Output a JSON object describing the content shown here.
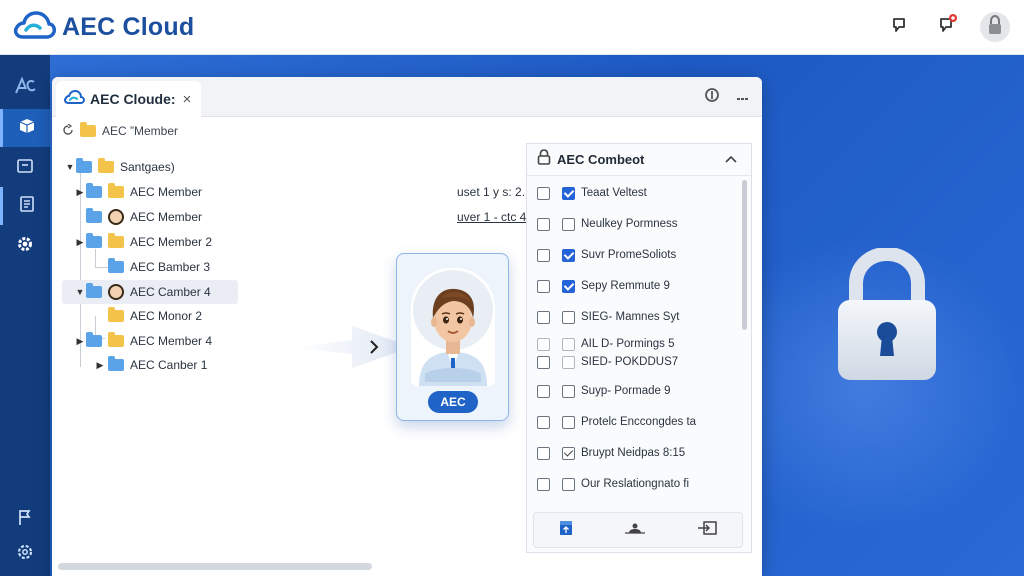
{
  "header": {
    "app_name": "AEC Cloud",
    "icons": [
      "cloud-logo-icon",
      "chat-icon",
      "notification-bell-icon",
      "user-avatar"
    ]
  },
  "rail": {
    "items": [
      "ae-logo-icon",
      "box-icon",
      "folder-icon",
      "document-icon",
      "gear-icon"
    ],
    "bottom_items": [
      "flag-icon",
      "settings-icon"
    ]
  },
  "window": {
    "tab_title": "AEC Cloude:",
    "tab_close": "×"
  },
  "breadcrumb": {
    "item": "AEC ”Member"
  },
  "tree": {
    "root": "Santgaes)",
    "rows": [
      {
        "label": "AEC Member",
        "icon": "folder"
      },
      {
        "label": "AEC Member",
        "icon": "avatar"
      },
      {
        "label": "AEC Member 2",
        "icon": "folder"
      },
      {
        "label": "AEC Bamber 3",
        "icon": "folder-blue"
      },
      {
        "label": "AEC Camber 4",
        "icon": "avatar"
      },
      {
        "label": "AEC Monor 2",
        "icon": "folder"
      },
      {
        "label": "AEC Member 4",
        "icon": "folder"
      },
      {
        "label": "AEC Canber 1",
        "icon": "folder-blue"
      }
    ],
    "notes": [
      "uset 1 y s: 2.",
      "uver 1 - ctc 4"
    ]
  },
  "profile_card": {
    "badge": "AEC"
  },
  "permissions": {
    "title": "AEC Combeot",
    "items": [
      {
        "label": "Teaat Veltest",
        "checked": true
      },
      {
        "label": "Neulkey Pormness",
        "checked": false
      },
      {
        "label": "Suvr PromeSoliots",
        "checked": true
      },
      {
        "label": "Sepy Remmute 9",
        "checked": true
      },
      {
        "label": "SIEG- Mamnes Syt",
        "checked": false
      },
      {
        "label": "AIL D- Pormings 5",
        "checked": false
      },
      {
        "label": "SIED- POKDDUS7",
        "checked": false
      },
      {
        "label": "Suyp- Pormade 9",
        "checked": false
      },
      {
        "label": "Protelc Enccongdes ta",
        "checked": false
      },
      {
        "label": "Bruypt Neidpas 8:15",
        "checked": "tick"
      },
      {
        "label": "Our Reslationgnato fi",
        "checked": false
      }
    ]
  },
  "colors": {
    "brand": "#1d4f9f",
    "accent": "#2563d8",
    "rail": "#123c7c",
    "background": "#1f5fc4"
  }
}
